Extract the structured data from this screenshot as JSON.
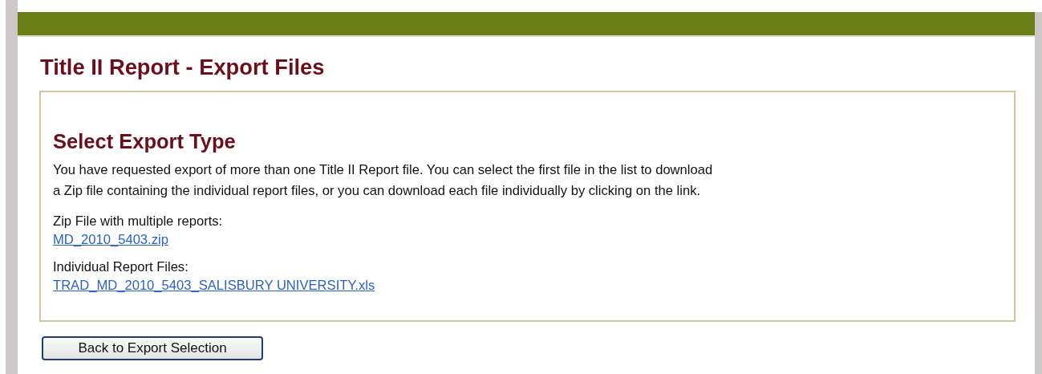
{
  "page_title": "Title II Report - Export Files",
  "section": {
    "heading": "Select Export Type",
    "intro_lines": [
      "You have requested export of more than one Title II Report file. You can select the first file in the list to download",
      "a Zip file containing the individual report files, or you can download each file individually by clicking on the link."
    ],
    "groups": [
      {
        "label": "Zip File with multiple reports:",
        "links": [
          "MD_2010_5403.zip"
        ]
      },
      {
        "label": "Individual Report Files:",
        "links": [
          "TRAD_MD_2010_5403_SALISBURY UNIVERSITY.xls"
        ]
      }
    ]
  },
  "back_button": "Back to Export Selection"
}
